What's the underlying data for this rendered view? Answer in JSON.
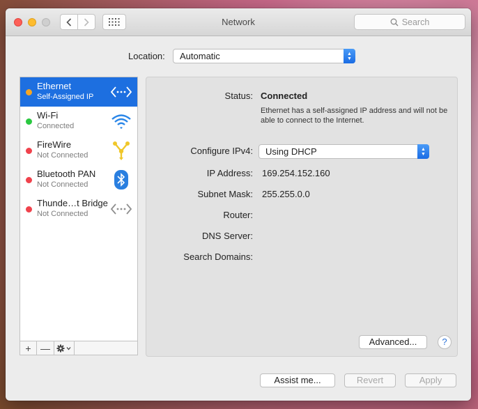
{
  "window": {
    "title": "Network",
    "search_placeholder": "Search"
  },
  "location": {
    "label": "Location:",
    "value": "Automatic"
  },
  "services": [
    {
      "name": "Ethernet",
      "status": "Self-Assigned IP",
      "dot": "#f6a623",
      "icon": "ethernet-icon",
      "selected": true
    },
    {
      "name": "Wi-Fi",
      "status": "Connected",
      "dot": "#2ac840",
      "icon": "wifi-icon",
      "selected": false
    },
    {
      "name": "FireWire",
      "status": "Not Connected",
      "dot": "#f0424c",
      "icon": "firewire-icon",
      "selected": false
    },
    {
      "name": "Bluetooth PAN",
      "status": "Not Connected",
      "dot": "#f0424c",
      "icon": "bluetooth-icon",
      "selected": false
    },
    {
      "name": "Thunde…t Bridge",
      "status": "Not Connected",
      "dot": "#f0424c",
      "icon": "thunderbolt-bridge-icon",
      "selected": false
    }
  ],
  "sidebar_controls": {
    "add": "+",
    "remove": "—"
  },
  "detail": {
    "status_label": "Status:",
    "status_value": "Connected",
    "status_description": "Ethernet has a self-assigned IP address and will not be able to connect to the Internet.",
    "configure_label": "Configure IPv4:",
    "configure_value": "Using DHCP",
    "ip_label": "IP Address:",
    "ip_value": "169.254.152.160",
    "subnet_label": "Subnet Mask:",
    "subnet_value": "255.255.0.0",
    "router_label": "Router:",
    "dns_label": "DNS Server:",
    "search_domains_label": "Search Domains:",
    "advanced_button": "Advanced...",
    "help_button": "?"
  },
  "footer": {
    "assist_button": "Assist me...",
    "revert_button": "Revert",
    "apply_button": "Apply"
  },
  "colors": {
    "selection": "#1d6fe0",
    "accent": "#2a72d8"
  }
}
